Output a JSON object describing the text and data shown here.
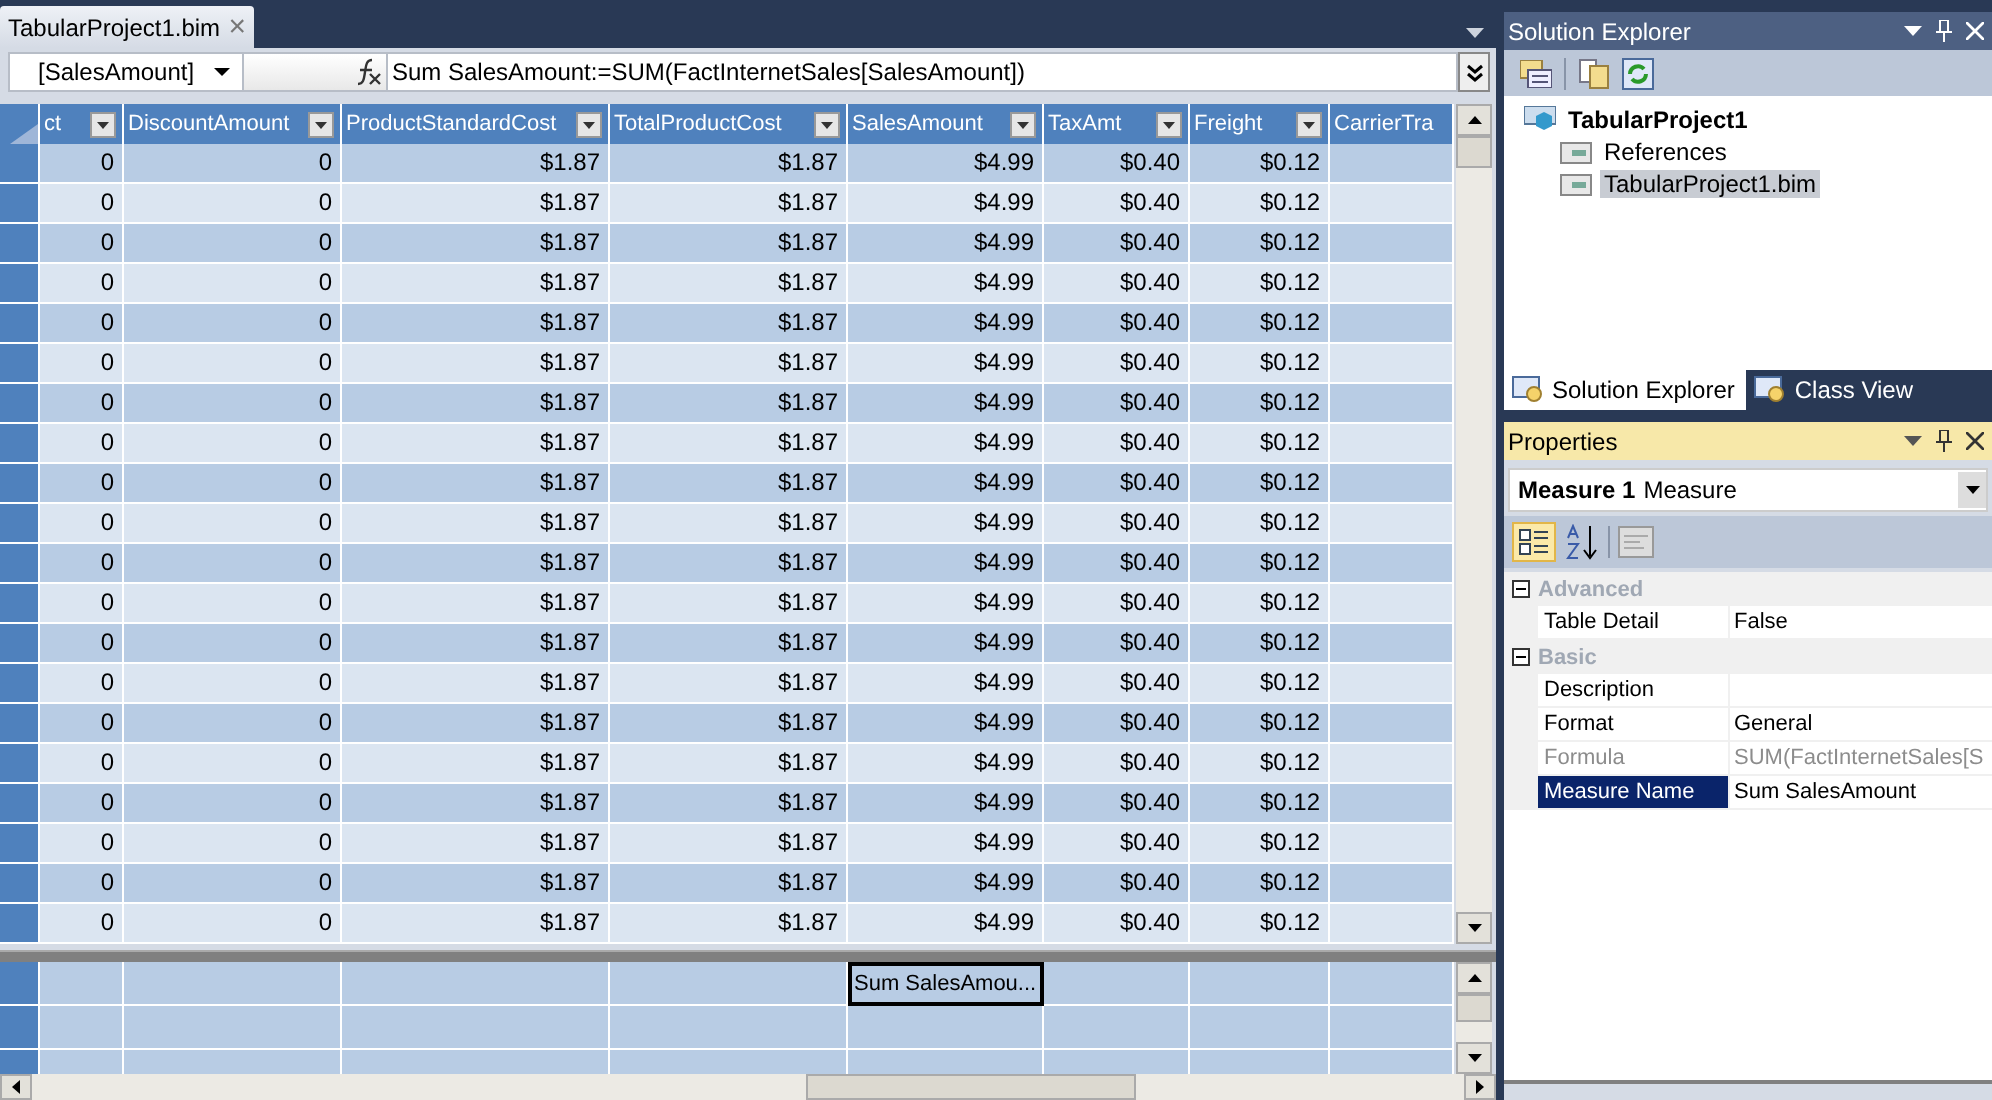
{
  "document_tab": {
    "title": "TabularProject1.bim",
    "close": "×"
  },
  "formula_bar": {
    "column_selector": "[SalesAmount]",
    "formula": "Sum SalesAmount:=SUM(FactInternetSales[SalesAmount])"
  },
  "table": {
    "columns": [
      "ct",
      "DiscountAmount",
      "ProductStandardCost",
      "TotalProductCost",
      "SalesAmount",
      "TaxAmt",
      "Freight",
      "CarrierTra"
    ],
    "rows": [
      [
        "0",
        "0",
        "$1.87",
        "$1.87",
        "$4.99",
        "$0.40",
        "$0.12"
      ],
      [
        "0",
        "0",
        "$1.87",
        "$1.87",
        "$4.99",
        "$0.40",
        "$0.12"
      ],
      [
        "0",
        "0",
        "$1.87",
        "$1.87",
        "$4.99",
        "$0.40",
        "$0.12"
      ],
      [
        "0",
        "0",
        "$1.87",
        "$1.87",
        "$4.99",
        "$0.40",
        "$0.12"
      ],
      [
        "0",
        "0",
        "$1.87",
        "$1.87",
        "$4.99",
        "$0.40",
        "$0.12"
      ],
      [
        "0",
        "0",
        "$1.87",
        "$1.87",
        "$4.99",
        "$0.40",
        "$0.12"
      ],
      [
        "0",
        "0",
        "$1.87",
        "$1.87",
        "$4.99",
        "$0.40",
        "$0.12"
      ],
      [
        "0",
        "0",
        "$1.87",
        "$1.87",
        "$4.99",
        "$0.40",
        "$0.12"
      ],
      [
        "0",
        "0",
        "$1.87",
        "$1.87",
        "$4.99",
        "$0.40",
        "$0.12"
      ],
      [
        "0",
        "0",
        "$1.87",
        "$1.87",
        "$4.99",
        "$0.40",
        "$0.12"
      ],
      [
        "0",
        "0",
        "$1.87",
        "$1.87",
        "$4.99",
        "$0.40",
        "$0.12"
      ],
      [
        "0",
        "0",
        "$1.87",
        "$1.87",
        "$4.99",
        "$0.40",
        "$0.12"
      ],
      [
        "0",
        "0",
        "$1.87",
        "$1.87",
        "$4.99",
        "$0.40",
        "$0.12"
      ],
      [
        "0",
        "0",
        "$1.87",
        "$1.87",
        "$4.99",
        "$0.40",
        "$0.12"
      ],
      [
        "0",
        "0",
        "$1.87",
        "$1.87",
        "$4.99",
        "$0.40",
        "$0.12"
      ],
      [
        "0",
        "0",
        "$1.87",
        "$1.87",
        "$4.99",
        "$0.40",
        "$0.12"
      ],
      [
        "0",
        "0",
        "$1.87",
        "$1.87",
        "$4.99",
        "$0.40",
        "$0.12"
      ],
      [
        "0",
        "0",
        "$1.87",
        "$1.87",
        "$4.99",
        "$0.40",
        "$0.12"
      ],
      [
        "0",
        "0",
        "$1.87",
        "$1.87",
        "$4.99",
        "$0.40",
        "$0.12"
      ],
      [
        "0",
        "0",
        "$1.87",
        "$1.87",
        "$4.99",
        "$0.40",
        "$0.12"
      ]
    ]
  },
  "measure_grid": {
    "rows": [
      [
        {
          "selected": false
        },
        {
          "selected": false
        },
        {
          "selected": false
        },
        {
          "selected": false
        },
        {
          "text": "Sum SalesAmou...",
          "selected": true
        },
        {
          "selected": false
        },
        {
          "selected": false
        },
        {
          "selected": false
        }
      ],
      [
        {
          "selected": false
        },
        {
          "selected": false
        },
        {
          "selected": false
        },
        {
          "selected": false
        },
        {
          "selected": false
        },
        {
          "selected": false
        },
        {
          "selected": false
        },
        {
          "selected": false
        }
      ],
      [
        {
          "selected": false
        },
        {
          "selected": false
        },
        {
          "selected": false
        },
        {
          "selected": false
        },
        {
          "selected": false
        },
        {
          "selected": false
        },
        {
          "selected": false
        },
        {
          "selected": false
        }
      ]
    ]
  },
  "solution_explorer": {
    "title": "Solution Explorer",
    "tree": [
      {
        "label": "TabularProject1",
        "selected": false,
        "children": [
          {
            "label": "References",
            "selected": false
          },
          {
            "label": "TabularProject1.bim",
            "selected": true
          }
        ]
      }
    ],
    "tabs": [
      {
        "label": "Solution Explorer",
        "selected": true
      },
      {
        "label": "Class View",
        "selected": false
      }
    ]
  },
  "properties": {
    "title": "Properties",
    "object_name": "Measure 1",
    "object_type": "Measure",
    "categories": [
      {
        "name": "Advanced",
        "expanded": true,
        "items": [
          {
            "name": "Table Detail",
            "value": "False",
            "disabled": false,
            "selected": false
          }
        ]
      },
      {
        "name": "Basic",
        "expanded": true,
        "items": [
          {
            "name": "Description",
            "disabled": false,
            "selected": false
          },
          {
            "name": "Format",
            "value": "General",
            "disabled": false,
            "selected": false
          },
          {
            "name": "Formula",
            "value": "SUM(FactInternetSales[S",
            "disabled": true,
            "selected": false
          },
          {
            "name": "Measure Name",
            "value": "Sum SalesAmount",
            "disabled": false,
            "selected": true
          }
        ]
      }
    ]
  }
}
